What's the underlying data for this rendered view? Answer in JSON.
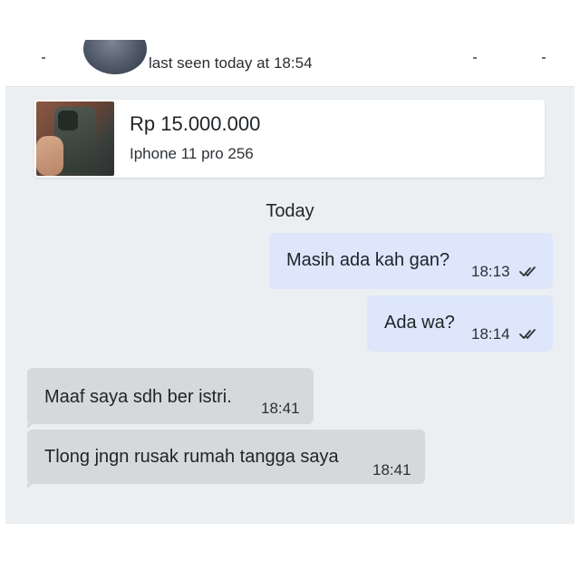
{
  "header": {
    "status": "last seen today at 18:54"
  },
  "product": {
    "price": "Rp 15.000.000",
    "name": "Iphone 11 pro 256"
  },
  "chat": {
    "date_label": "Today",
    "messages": [
      {
        "direction": "outgoing",
        "text": "Masih ada kah gan?",
        "time": "18:13",
        "status": "read"
      },
      {
        "direction": "outgoing",
        "text": "Ada wa?",
        "time": "18:14",
        "status": "read"
      },
      {
        "direction": "incoming",
        "text": "Maaf saya sdh ber istri.",
        "time": "18:41"
      },
      {
        "direction": "incoming",
        "text": "Tlong jngn rusak rumah tangga saya",
        "time": "18:41"
      }
    ]
  },
  "colors": {
    "chat_background": "#eceff1",
    "outgoing_bubble": "#dde6fb",
    "incoming_bubble": "#d6d9dc",
    "read_ticks": "#2b3034"
  }
}
